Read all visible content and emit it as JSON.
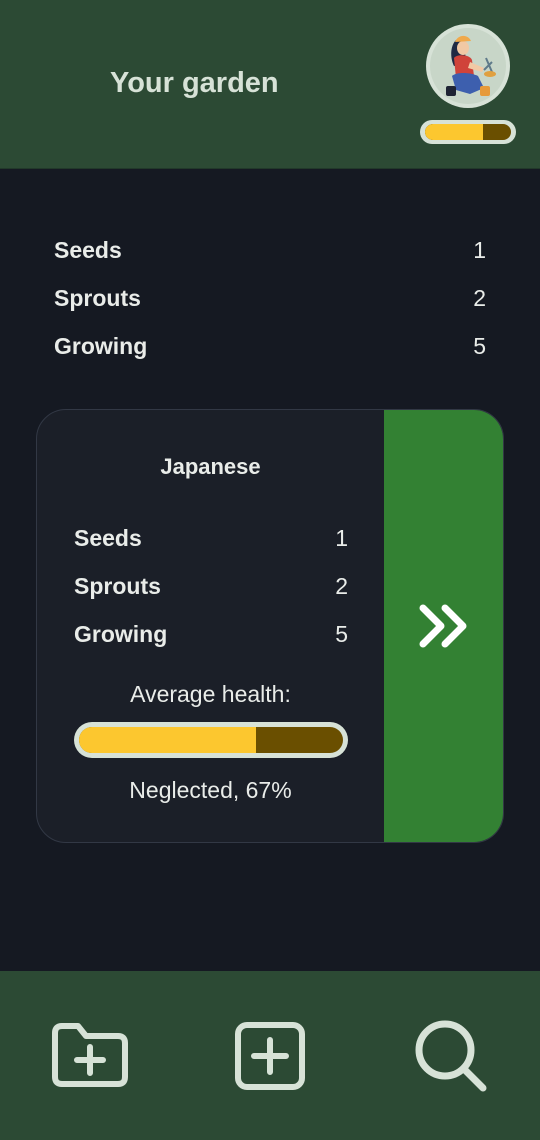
{
  "header": {
    "title": "Your garden",
    "avatar_icon": "gardener-avatar-icon",
    "health_fraction": 0.67
  },
  "summary": [
    {
      "label": "Seeds",
      "value": "1"
    },
    {
      "label": "Sprouts",
      "value": "2"
    },
    {
      "label": "Growing",
      "value": "5"
    }
  ],
  "card": {
    "title": "Japanese",
    "rows": [
      {
        "label": "Seeds",
        "value": "1"
      },
      {
        "label": "Sprouts",
        "value": "2"
      },
      {
        "label": "Growing",
        "value": "5"
      }
    ],
    "health_label": "Average health:",
    "health_fraction": 0.67,
    "health_status": "Neglected, 67%",
    "go_icon": "double-chevron-right-icon"
  },
  "nav": {
    "items": [
      {
        "icon": "folder-plus-icon"
      },
      {
        "icon": "square-plus-icon"
      },
      {
        "icon": "search-icon"
      }
    ]
  },
  "colors": {
    "header_bg": "#2c4a34",
    "page_bg": "#151922",
    "card_bg": "#1b1f28",
    "accent_green": "#338133",
    "health_fill": "#fcc72f",
    "health_track": "#6a4f00",
    "icon_light": "#d7e2d7"
  }
}
